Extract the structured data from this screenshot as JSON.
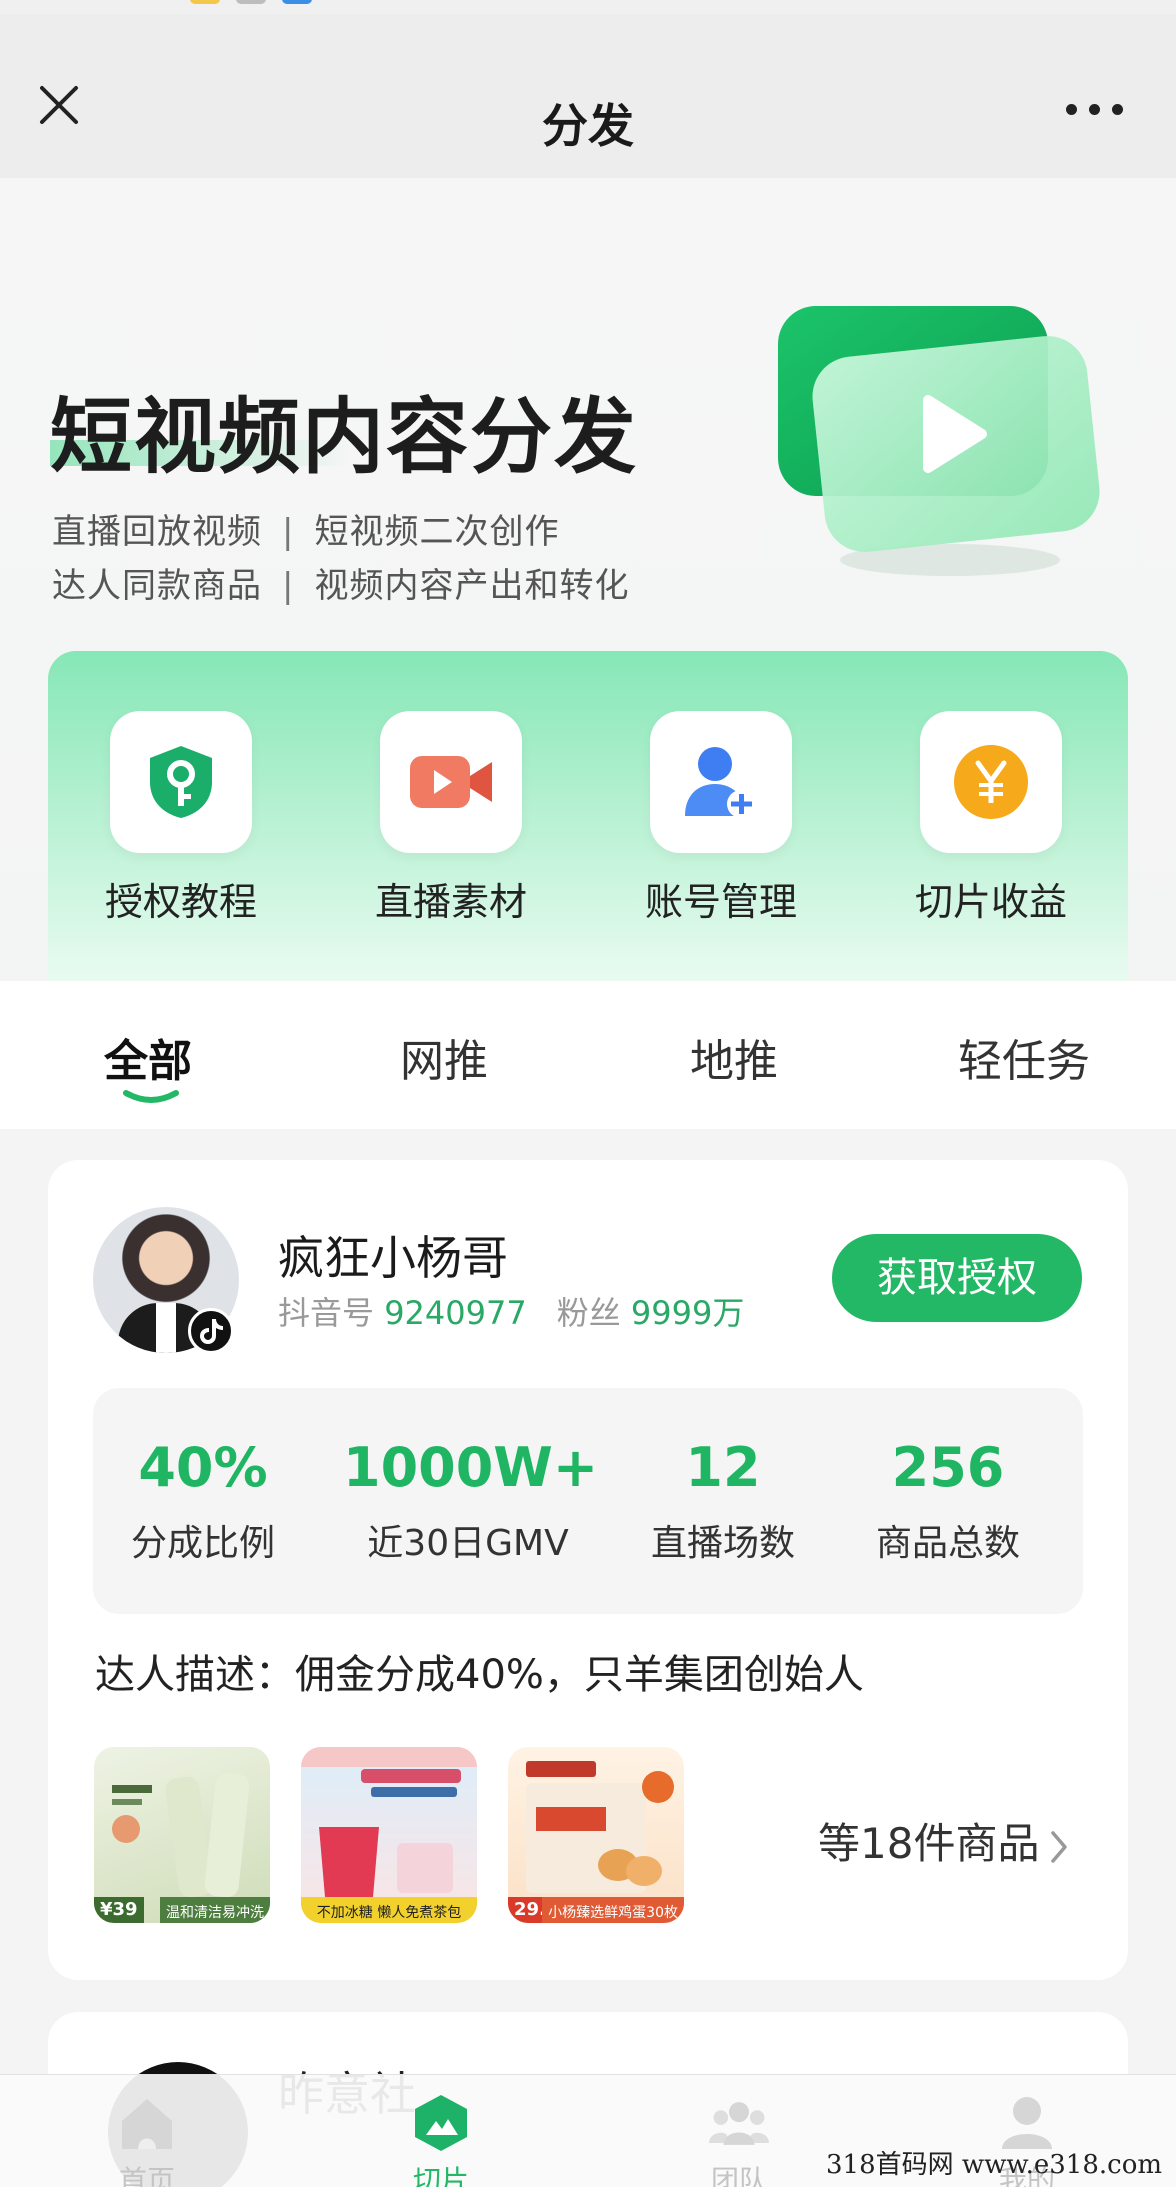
{
  "nav": {
    "title": "分发"
  },
  "hero": {
    "title": "短视频内容分发",
    "line1_a": "直播回放视频",
    "line1_b": "短视频二次创作",
    "line2_a": "达人同款商品",
    "line2_b": "视频内容产出和转化",
    "separator": "|"
  },
  "features": [
    {
      "label": "授权教程",
      "icon": "shield-key-icon"
    },
    {
      "label": "直播素材",
      "icon": "video-camera-icon"
    },
    {
      "label": "账号管理",
      "icon": "user-add-icon"
    },
    {
      "label": "切片收益",
      "icon": "yen-coin-icon"
    }
  ],
  "tabs": [
    {
      "label": "全部",
      "active": true
    },
    {
      "label": "网推"
    },
    {
      "label": "地推"
    },
    {
      "label": "轻任务"
    }
  ],
  "creator": {
    "name": "疯狂小杨哥",
    "douyin_label": "抖音号",
    "douyin_id": "9240977",
    "fans_label": "粉丝",
    "fans": "9999万",
    "auth_button": "获取授权",
    "stats": [
      {
        "value": "40%",
        "label": "分成比例"
      },
      {
        "value": "1000W+",
        "label": "近30日GMV"
      },
      {
        "value": "12",
        "label": "直播场数"
      },
      {
        "value": "256",
        "label": "商品总数"
      }
    ],
    "description": "达人描述：佣金分成40%，只羊集团创始人",
    "products": [
      {
        "price": "¥39",
        "caption": "温和清洁易冲洗"
      },
      {
        "price": "",
        "caption": "不加冰糖 懒人免煮茶包"
      },
      {
        "price": "29.9",
        "caption": "小杨臻选鲜鸡蛋30枚"
      }
    ],
    "more_products": "等18件商品"
  },
  "next_card": {
    "name": "昨意社"
  },
  "tabbar": [
    {
      "label": "首页",
      "icon": "home-icon"
    },
    {
      "label": "切片",
      "icon": "mountain-hex-icon",
      "active": true
    },
    {
      "label": "团队",
      "icon": "team-icon"
    },
    {
      "label": "我的",
      "icon": "user-icon"
    }
  ],
  "watermark": "318首码网 www.e318.com",
  "colors": {
    "accent": "#22b865",
    "stat_green": "#1fb563",
    "feature_bg": "#86e7b6"
  }
}
